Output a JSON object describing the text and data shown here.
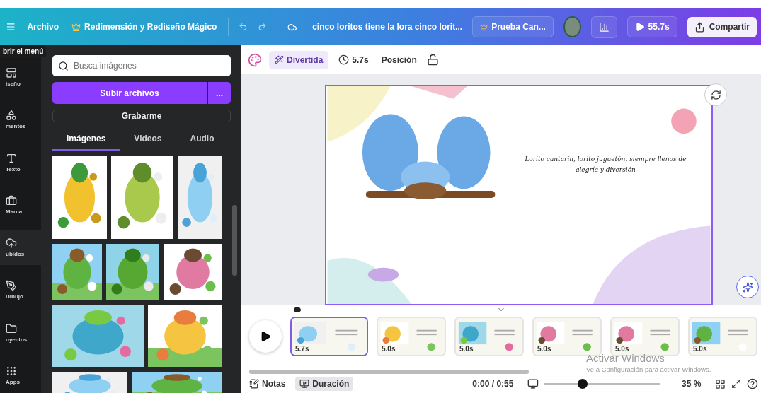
{
  "topbar": {
    "menu_tooltip": "brir el menú",
    "file_menu": "Archivo",
    "magic_button": "Redimensión y Rediseño Mágico",
    "document_title": "cinco loritos tiene la lora cinco lorit...",
    "trial_button": "Prueba Can...",
    "play_button": "55.7s",
    "share_button": "Compartir"
  },
  "rail": [
    {
      "label": "iseño",
      "selected": false
    },
    {
      "label": "mentos",
      "selected": false
    },
    {
      "label": "Texto",
      "selected": false
    },
    {
      "label": "Marca",
      "selected": false
    },
    {
      "label": "ubidos",
      "selected": true
    },
    {
      "label": "Dibujo",
      "selected": false
    },
    {
      "label": "oyectos",
      "selected": false
    },
    {
      "label": "Apps",
      "selected": false
    }
  ],
  "panel": {
    "search": {
      "placeholder": "Busca imágenes"
    },
    "upload_button": "Subir archivos",
    "more_button": "...",
    "record_button": "Grabarme",
    "tabs": [
      {
        "label": "Imágenes",
        "selected": true
      },
      {
        "label": "Videos",
        "selected": false
      },
      {
        "label": "Audio",
        "selected": false
      }
    ]
  },
  "toolbar": {
    "style_chip": "Divertida",
    "duration": "5.7s",
    "position_button": "Posición"
  },
  "slide": {
    "caption": "Lorito cantarín, lorito juguetón, siempre llenos de alegría y diversión"
  },
  "timeline": {
    "scenes": [
      {
        "duration": "5.7s",
        "selected": true
      },
      {
        "duration": "5.0s",
        "selected": false
      },
      {
        "duration": "5.0s",
        "selected": false
      },
      {
        "duration": "5.0s",
        "selected": false
      },
      {
        "duration": "5.0s",
        "selected": false
      },
      {
        "duration": "5.0s",
        "selected": false
      }
    ]
  },
  "bottombar": {
    "notes_button": "Notas",
    "duration_button": {
      "label": "Duración",
      "selected": true
    },
    "time": "0:00 / 0:55",
    "zoom": {
      "level": 0.33
    },
    "zoom_reading": "35 %"
  },
  "os_notice": {
    "title": "Activar Windows",
    "subtitle": "Ve a Configuración para activar Windows."
  }
}
